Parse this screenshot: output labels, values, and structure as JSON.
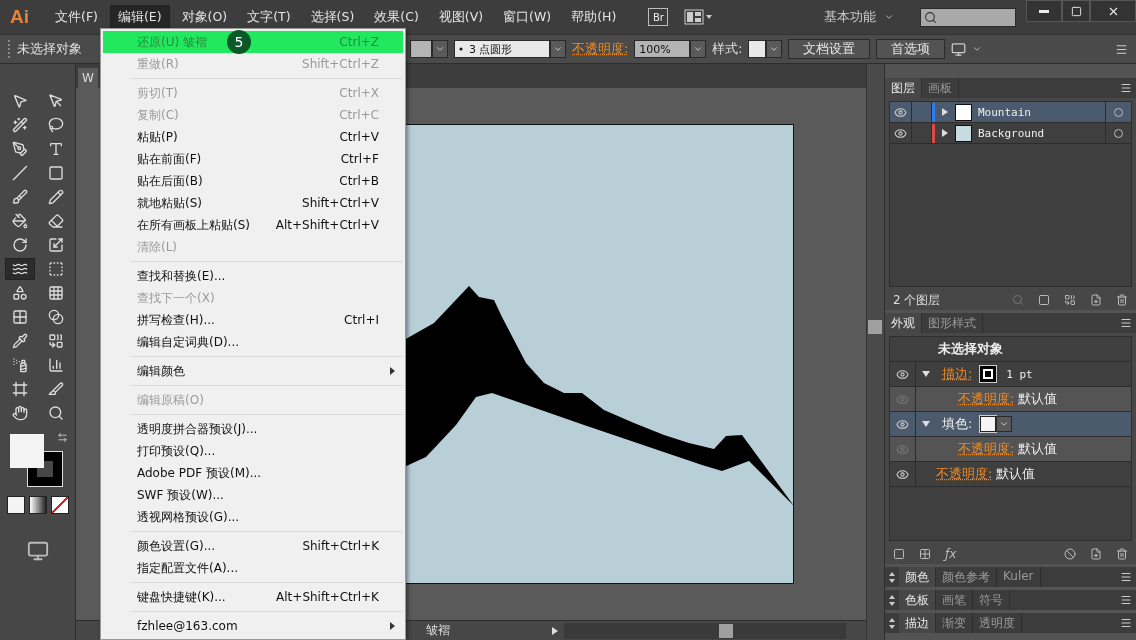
{
  "app_logo": "Ai",
  "menubar": [
    {
      "label": "文件(F)",
      "selected": false
    },
    {
      "label": "编辑(E)",
      "selected": true
    },
    {
      "label": "对象(O)",
      "selected": false
    },
    {
      "label": "文字(T)",
      "selected": false
    },
    {
      "label": "选择(S)",
      "selected": false
    },
    {
      "label": "效果(C)",
      "selected": false
    },
    {
      "label": "视图(V)",
      "selected": false
    },
    {
      "label": "窗口(W)",
      "selected": false
    },
    {
      "label": "帮助(H)",
      "selected": false
    }
  ],
  "bridge_button": "Br",
  "workspace": "基本功能",
  "control_bar": {
    "selection": "未选择对象",
    "brush": "3 点圆形",
    "opacity_label": "不透明度:",
    "opacity": "100%",
    "style_label": "样式:",
    "buttons": [
      "文档设置",
      "首选项"
    ]
  },
  "tools": [
    {
      "selected": false
    },
    {
      "selected": false
    },
    {
      "selected": false
    },
    {
      "selected": false
    },
    {
      "selected": false
    },
    {
      "selected": false
    },
    {
      "selected": false
    },
    {
      "selected": false
    },
    {
      "selected": false
    },
    {
      "selected": false
    },
    {
      "selected": false
    },
    {
      "selected": false
    },
    {
      "selected": false
    },
    {
      "selected": false
    },
    {
      "selected": true
    },
    {
      "selected": false
    },
    {
      "selected": false
    },
    {
      "selected": false
    },
    {
      "selected": false
    },
    {
      "selected": false
    },
    {
      "selected": false
    },
    {
      "selected": false
    },
    {
      "selected": false
    },
    {
      "selected": false
    },
    {
      "selected": false
    },
    {
      "selected": false
    },
    {
      "selected": false
    },
    {
      "selected": false
    }
  ],
  "document": {
    "tab_title": "W",
    "status": "皱褶"
  },
  "edit_menu": {
    "groups": [
      [
        {
          "label": "还原(U) 皱褶",
          "shortcut": "Ctrl+Z",
          "disabled": false,
          "selected": true,
          "submenu": false
        },
        {
          "label": "重做(R)",
          "shortcut": "Shift+Ctrl+Z",
          "disabled": true,
          "selected": false,
          "submenu": false
        }
      ],
      [
        {
          "label": "剪切(T)",
          "shortcut": "Ctrl+X",
          "disabled": true,
          "selected": false,
          "submenu": false
        },
        {
          "label": "复制(C)",
          "shortcut": "Ctrl+C",
          "disabled": true,
          "selected": false,
          "submenu": false
        },
        {
          "label": "粘贴(P)",
          "shortcut": "Ctrl+V",
          "disabled": false,
          "selected": false,
          "submenu": false
        },
        {
          "label": "贴在前面(F)",
          "shortcut": "Ctrl+F",
          "disabled": false,
          "selected": false,
          "submenu": false
        },
        {
          "label": "贴在后面(B)",
          "shortcut": "Ctrl+B",
          "disabled": false,
          "selected": false,
          "submenu": false
        },
        {
          "label": "就地粘贴(S)",
          "shortcut": "Shift+Ctrl+V",
          "disabled": false,
          "selected": false,
          "submenu": false
        },
        {
          "label": "在所有画板上粘贴(S)",
          "shortcut": "Alt+Shift+Ctrl+V",
          "disabled": false,
          "selected": false,
          "submenu": false
        },
        {
          "label": "清除(L)",
          "disabled": true,
          "selected": false,
          "submenu": false
        }
      ],
      [
        {
          "label": "查找和替换(E)...",
          "disabled": false,
          "selected": false,
          "submenu": false
        },
        {
          "label": "查找下一个(X)",
          "disabled": true,
          "selected": false,
          "submenu": false
        },
        {
          "label": "拼写检查(H)...",
          "shortcut": "Ctrl+I",
          "disabled": false,
          "selected": false,
          "submenu": false
        },
        {
          "label": "编辑自定词典(D)...",
          "disabled": false,
          "selected": false,
          "submenu": false
        }
      ],
      [
        {
          "label": "编辑颜色",
          "disabled": false,
          "selected": false,
          "submenu": true
        }
      ],
      [
        {
          "label": "编辑原稿(O)",
          "disabled": true,
          "selected": false,
          "submenu": false
        }
      ],
      [
        {
          "label": "透明度拼合器预设(J)...",
          "disabled": false,
          "selected": false,
          "submenu": false
        },
        {
          "label": "打印预设(Q)...",
          "disabled": false,
          "selected": false,
          "submenu": false
        },
        {
          "label": "Adobe PDF 预设(M)...",
          "disabled": false,
          "selected": false,
          "submenu": false
        },
        {
          "label": "SWF 预设(W)...",
          "disabled": false,
          "selected": false,
          "submenu": false
        },
        {
          "label": "透视网格预设(G)...",
          "disabled": false,
          "selected": false,
          "submenu": false
        }
      ],
      [
        {
          "label": "颜色设置(G)...",
          "shortcut": "Shift+Ctrl+K",
          "disabled": false,
          "selected": false,
          "submenu": false
        },
        {
          "label": "指定配置文件(A)...",
          "disabled": false,
          "selected": false,
          "submenu": false
        }
      ],
      [
        {
          "label": "键盘快捷键(K)...",
          "shortcut": "Alt+Shift+Ctrl+K",
          "disabled": false,
          "selected": false,
          "submenu": false
        }
      ],
      [
        {
          "label": "fzhlee@163.com",
          "disabled": false,
          "selected": false,
          "submenu": true
        }
      ]
    ]
  },
  "step_badge": "5",
  "layers_panel": {
    "tabs": [
      {
        "label": "图层",
        "selected": true
      },
      {
        "label": "画板",
        "selected": false
      }
    ],
    "layers": [
      {
        "name": "Mountain",
        "color": "#2f7cf0",
        "selected": true,
        "visible": true
      },
      {
        "name": "Background",
        "color": "#e04848",
        "selected": false,
        "visible": true
      }
    ],
    "count": "2 个图层"
  },
  "appearance_panel": {
    "tabs": [
      {
        "label": "外观",
        "selected": true
      },
      {
        "label": "图形样式",
        "selected": false
      }
    ],
    "title": "未选择对象",
    "rows": [
      {
        "kind": "stroke",
        "label": "描边:",
        "value": "1 pt",
        "selected": false,
        "expanded": true,
        "children": [
          {
            "kind": "opacity",
            "label": "不透明度:",
            "value": "默认值",
            "selected": false
          }
        ]
      },
      {
        "kind": "fill",
        "label": "填色:",
        "selected": true,
        "expanded": true,
        "children": [
          {
            "kind": "opacity",
            "label": "不透明度:",
            "value": "默认值",
            "selected": false
          }
        ]
      },
      {
        "kind": "opacity",
        "label": "不透明度:",
        "value": "默认值",
        "selected": false
      }
    ],
    "fx_label": "ƒx"
  },
  "collapsed_panels": [
    {
      "tabs": [
        {
          "label": "颜色",
          "selected": true
        },
        {
          "label": "颜色参考",
          "selected": false
        },
        {
          "label": "Kuler",
          "selected": false
        }
      ]
    },
    {
      "tabs": [
        {
          "label": "色板",
          "selected": true
        },
        {
          "label": "画笔",
          "selected": false
        },
        {
          "label": "符号",
          "selected": false
        }
      ]
    },
    {
      "tabs": [
        {
          "label": "描边",
          "selected": true
        },
        {
          "label": "渐变",
          "selected": false
        },
        {
          "label": "透明度",
          "selected": false
        }
      ]
    }
  ]
}
